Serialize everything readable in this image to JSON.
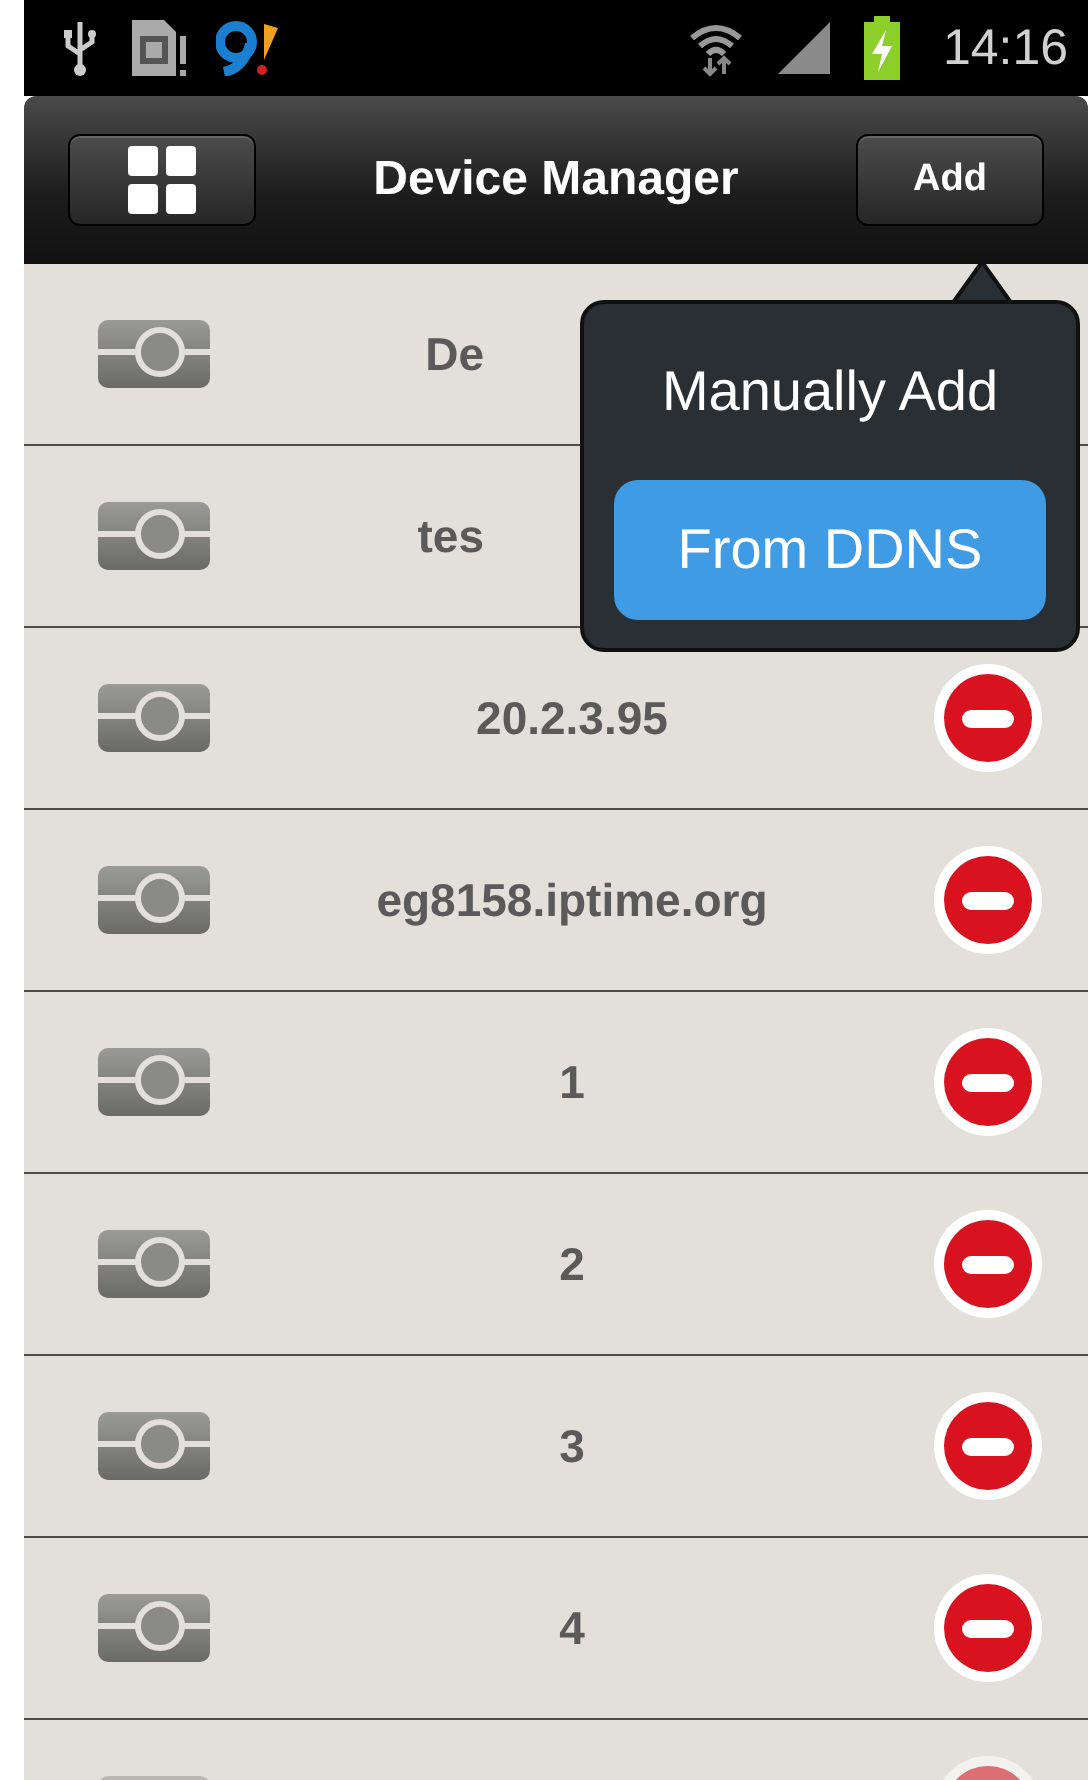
{
  "status_bar": {
    "time": "14:16"
  },
  "header": {
    "title": "Device Manager",
    "add_button": "Add"
  },
  "devices": [
    {
      "name": "De",
      "delete_button": false
    },
    {
      "name": "tes",
      "delete_button": false
    },
    {
      "name": "20.2.3.95",
      "delete_button": true
    },
    {
      "name": "eg8158.iptime.org",
      "delete_button": true
    },
    {
      "name": "1",
      "delete_button": true
    },
    {
      "name": "2",
      "delete_button": true
    },
    {
      "name": "3",
      "delete_button": true
    },
    {
      "name": "4",
      "delete_button": true
    },
    {
      "delete_button": true
    }
  ],
  "add_menu": [
    {
      "label": "Manually Add",
      "selected": false
    },
    {
      "label": "From DDNS",
      "selected": true
    }
  ]
}
